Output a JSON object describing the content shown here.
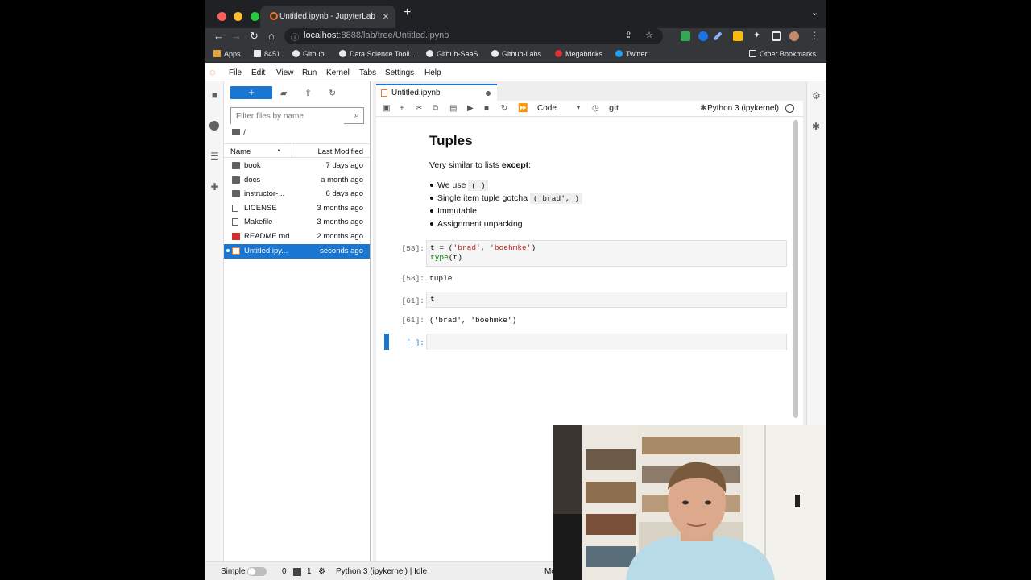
{
  "browser": {
    "tab_title": "Untitled.ipynb - JupyterLab",
    "url_host": "localhost",
    "url_rest": ":8888/lab/tree/Untitled.ipynb",
    "bookmarks": [
      "Apps",
      "8451",
      "Github",
      "Data Science Tooli...",
      "Github-SaaS",
      "Github-Labs",
      "Megabricks",
      "Twitter",
      "Other Bookmarks"
    ]
  },
  "menu": [
    "File",
    "Edit",
    "View",
    "Run",
    "Kernel",
    "Tabs",
    "Settings",
    "Help"
  ],
  "filebrowser": {
    "new_label": "+",
    "filter_placeholder": "Filter files by name",
    "breadcrumb": "/",
    "col_name": "Name",
    "col_modified": "Last Modified",
    "files": [
      {
        "name": "book",
        "modified": "7 days ago",
        "type": "folder"
      },
      {
        "name": "docs",
        "modified": "a month ago",
        "type": "folder"
      },
      {
        "name": "instructor-...",
        "modified": "6 days ago",
        "type": "folder"
      },
      {
        "name": "LICENSE",
        "modified": "3 months ago",
        "type": "file"
      },
      {
        "name": "Makefile",
        "modified": "3 months ago",
        "type": "file"
      },
      {
        "name": "README.md",
        "modified": "2 months ago",
        "type": "markdown"
      },
      {
        "name": "Untitled.ipy...",
        "modified": "seconds ago",
        "type": "notebook",
        "selected": true
      }
    ]
  },
  "notebook": {
    "tab_title": "Untitled.ipynb",
    "cell_type": "Code",
    "git_label": "git",
    "kernel": "Python 3 (ipykernel)",
    "heading": "Tuples",
    "intro_prefix": "Very similar to lists ",
    "intro_bold": "except",
    "intro_suffix": ":",
    "bullets": {
      "b1_text": "We use ",
      "b1_code": "( )",
      "b2_text": "Single item tuple gotcha ",
      "b2_code": "('brad', )",
      "b3_text": "Immutable",
      "b4_text": "Assignment unpacking"
    },
    "cells": {
      "c1_prompt": "[58]:",
      "c1_out_prompt": "[58]:",
      "c1_output": "tuple",
      "c2_prompt": "[61]:",
      "c2_code": "t",
      "c2_out_prompt": "[61]:",
      "c2_output": "('brad', 'boehmke')",
      "c3_prompt": "[ ]:"
    }
  },
  "status": {
    "mode": "Simple",
    "count0": "0",
    "count1": "1",
    "kernel_status": "Python 3 (ipykernel) | Idle",
    "right_text": "Mo"
  }
}
